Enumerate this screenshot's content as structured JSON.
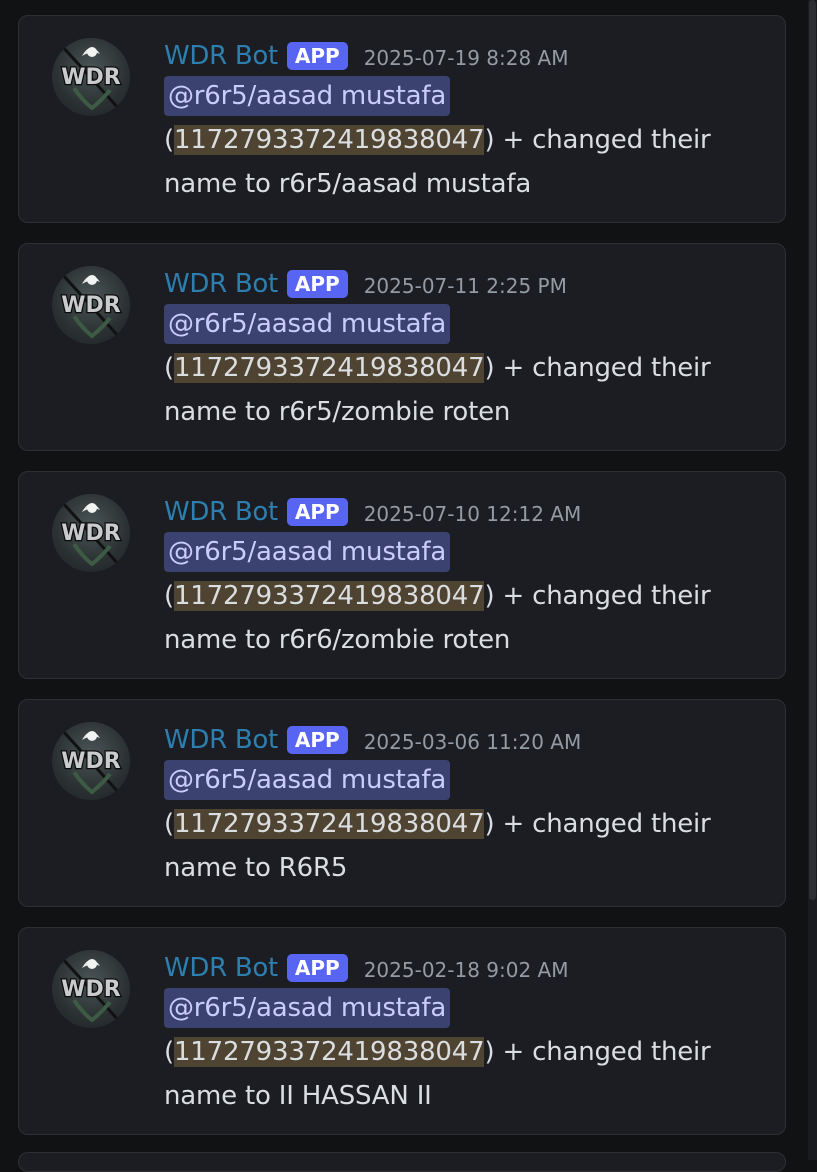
{
  "messages": [
    {
      "username": "WDR Bot",
      "badge": "APP",
      "timestamp": "2025-07-19 8:28 AM",
      "mention": "@r6r5/aasad mustafa",
      "id": "1172793372419838047",
      "text": ") + changed their name to r6r5/aasad mustafa",
      "avatar_text": "WDR"
    },
    {
      "username": "WDR Bot",
      "badge": "APP",
      "timestamp": "2025-07-11 2:25 PM",
      "mention": "@r6r5/aasad mustafa",
      "id": "1172793372419838047",
      "text": ") + changed their name to r6r5/zombie roten",
      "avatar_text": "WDR"
    },
    {
      "username": "WDR Bot",
      "badge": "APP",
      "timestamp": "2025-07-10 12:12 AM",
      "mention": "@r6r5/aasad mustafa",
      "id": "1172793372419838047",
      "text": ") + changed their name to r6r6/zombie roten",
      "avatar_text": "WDR"
    },
    {
      "username": "WDR Bot",
      "badge": "APP",
      "timestamp": "2025-03-06 11:20 AM",
      "mention": "@r6r5/aasad mustafa",
      "id": "1172793372419838047",
      "text": ") + changed their name to R6R5",
      "avatar_text": "WDR"
    },
    {
      "username": "WDR Bot",
      "badge": "APP",
      "timestamp": "2025-02-18 9:02 AM",
      "mention": "@r6r5/aasad mustafa",
      "id": "1172793372419838047",
      "text": ") + changed their name to II HASSAN II",
      "avatar_text": "WDR"
    }
  ],
  "paren_open": "(",
  "colors": {
    "username": "#2d7fb0",
    "badge_bg": "#5865f2",
    "mention_bg": "#3c4270",
    "id_highlight": "#4f4431",
    "card_bg": "#1c1d22",
    "page_bg": "#111214"
  }
}
